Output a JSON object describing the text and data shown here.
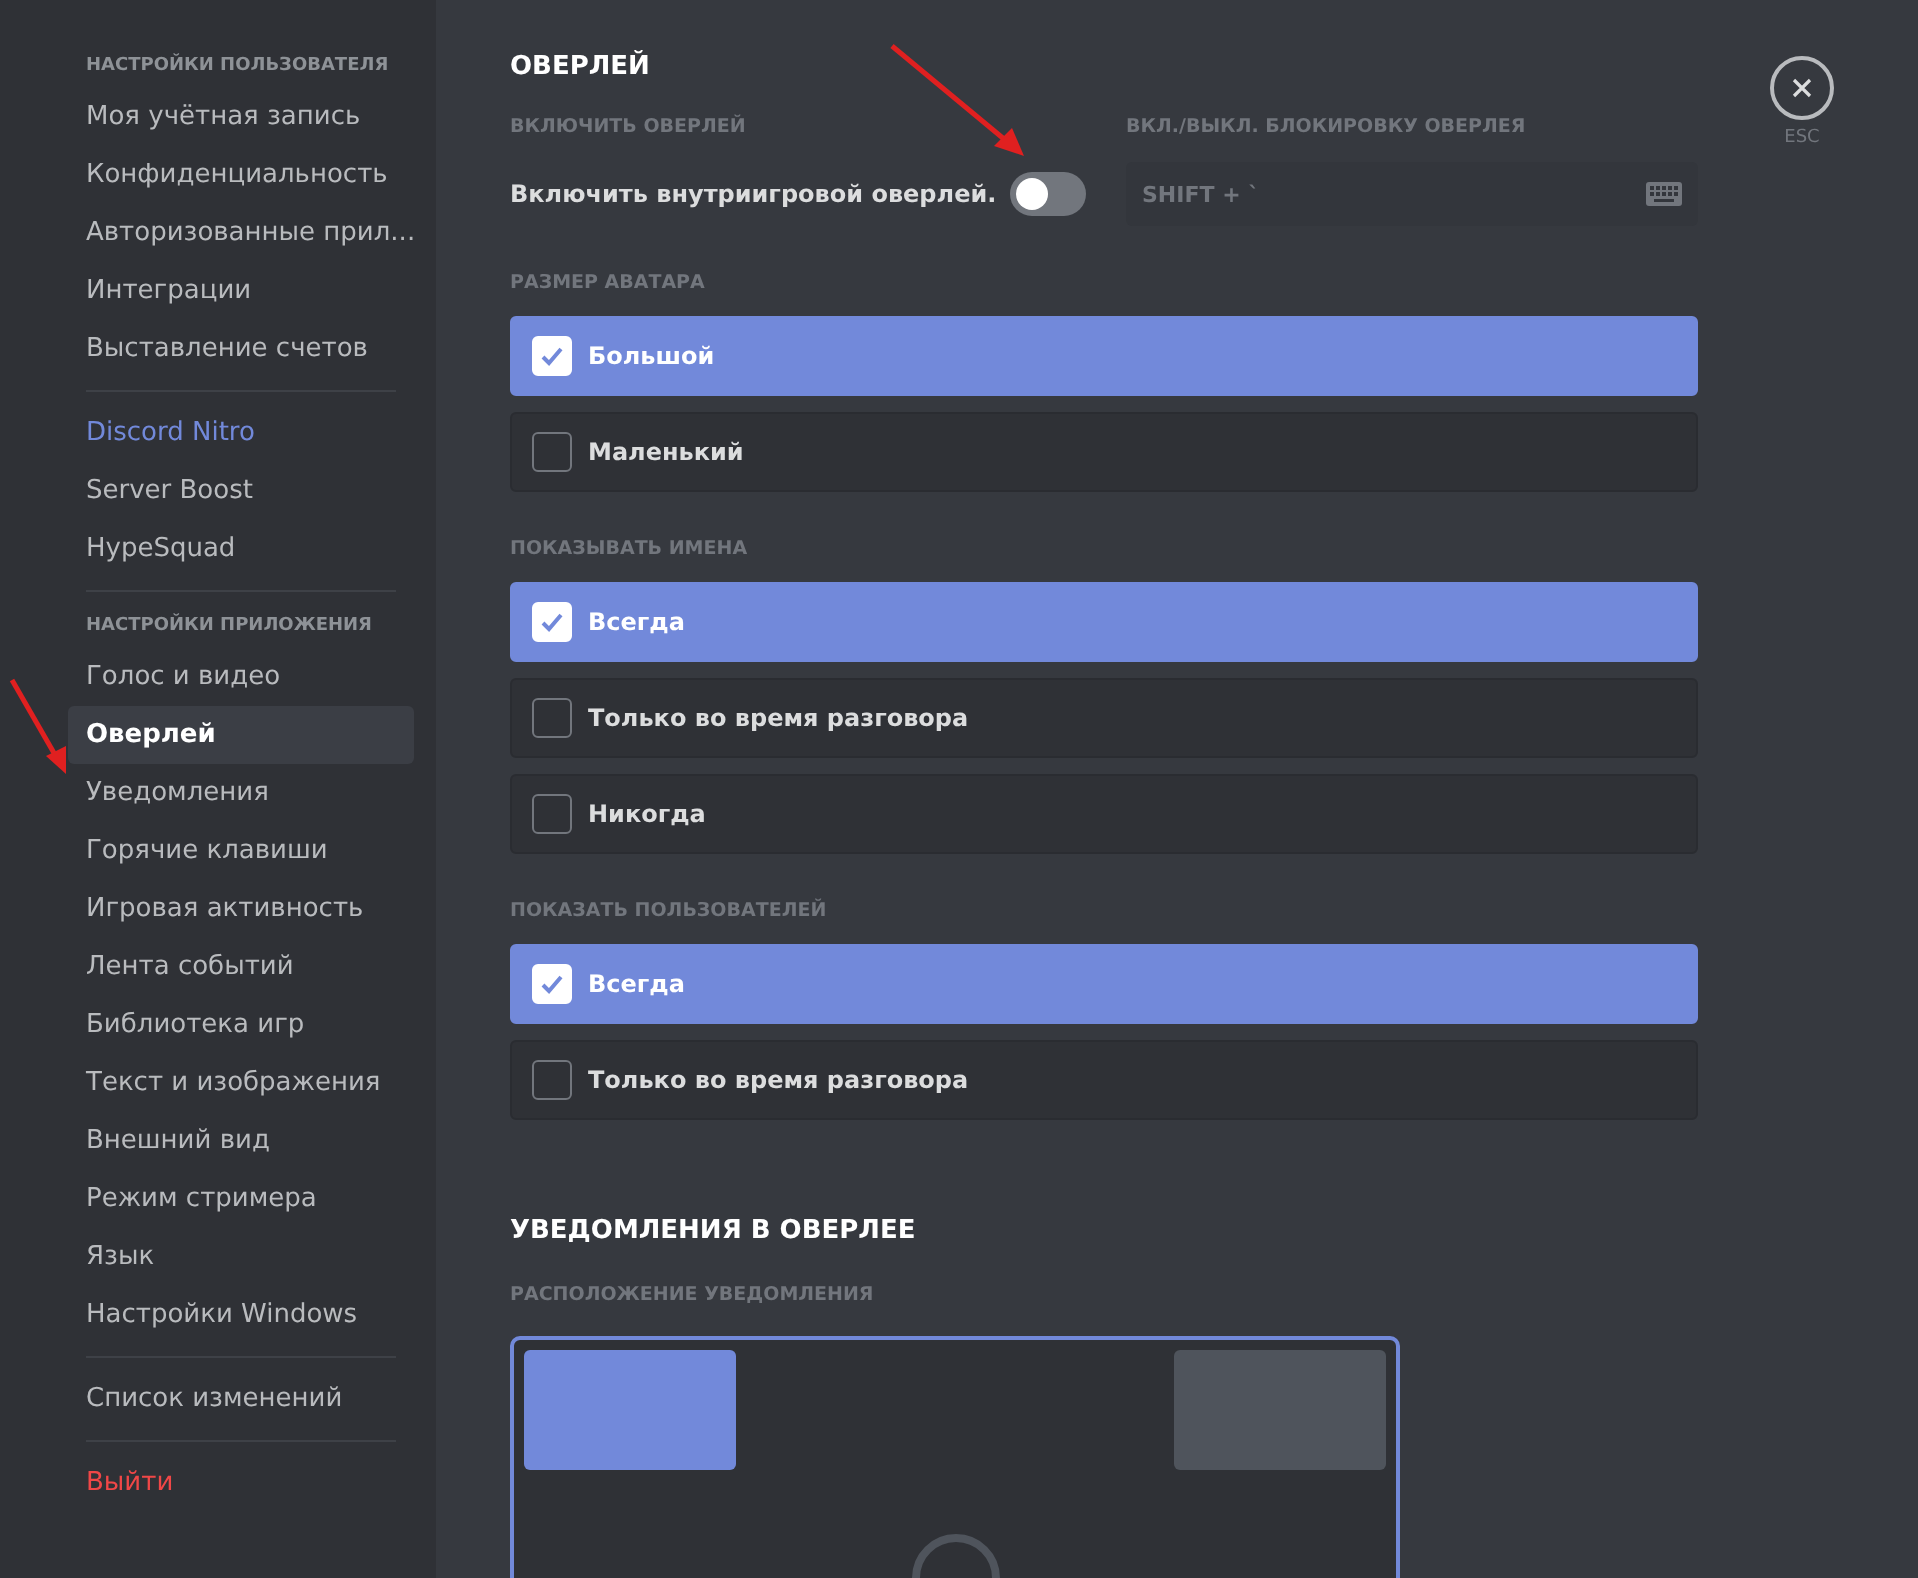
{
  "sidebar": {
    "sections": [
      {
        "header": "НАСТРОЙКИ ПОЛЬЗОВАТЕЛЯ",
        "items": [
          {
            "label": "Моя учётная запись",
            "kind": "normal",
            "selected": false
          },
          {
            "label": "Конфиденциальность",
            "kind": "normal",
            "selected": false
          },
          {
            "label": "Авторизованные прил...",
            "kind": "normal",
            "selected": false
          },
          {
            "label": "Интеграции",
            "kind": "normal",
            "selected": false
          },
          {
            "label": "Выставление счетов",
            "kind": "normal",
            "selected": false
          }
        ]
      },
      {
        "items": [
          {
            "label": "Discord Nitro",
            "kind": "accent",
            "selected": false
          },
          {
            "label": "Server Boost",
            "kind": "normal",
            "selected": false
          },
          {
            "label": "HypeSquad",
            "kind": "normal",
            "selected": false
          }
        ]
      },
      {
        "header": "НАСТРОЙКИ ПРИЛОЖЕНИЯ",
        "items": [
          {
            "label": "Голос и видео",
            "kind": "normal",
            "selected": false
          },
          {
            "label": "Оверлей",
            "kind": "normal",
            "selected": true
          },
          {
            "label": "Уведомления",
            "kind": "normal",
            "selected": false
          },
          {
            "label": "Горячие клавиши",
            "kind": "normal",
            "selected": false
          },
          {
            "label": "Игровая активность",
            "kind": "normal",
            "selected": false
          },
          {
            "label": "Лента событий",
            "kind": "normal",
            "selected": false
          },
          {
            "label": "Библиотека игр",
            "kind": "normal",
            "selected": false
          },
          {
            "label": "Текст и изображения",
            "kind": "normal",
            "selected": false
          },
          {
            "label": "Внешний вид",
            "kind": "normal",
            "selected": false
          },
          {
            "label": "Режим стримера",
            "kind": "normal",
            "selected": false
          },
          {
            "label": "Язык",
            "kind": "normal",
            "selected": false
          },
          {
            "label": "Настройки Windows",
            "kind": "normal",
            "selected": false
          }
        ]
      },
      {
        "items": [
          {
            "label": "Список изменений",
            "kind": "normal",
            "selected": false
          }
        ]
      },
      {
        "items": [
          {
            "label": "Выйти",
            "kind": "danger",
            "selected": false
          }
        ]
      }
    ]
  },
  "overlay": {
    "title": "ОВЕРЛЕЙ",
    "enable_header": "ВКЛЮЧИТЬ ОВЕРЛЕЙ",
    "toggle_label": "Включить внутриигровой оверлей.",
    "toggle_on": false,
    "keybind_header": "ВКЛ./ВЫКЛ. БЛОКИРОВКУ ОВЕРЛЕЯ",
    "keybind_value": "SHIFT + `"
  },
  "close": {
    "label": "ESC"
  },
  "option_groups": [
    {
      "title": "РАЗМЕР АВАТАРА",
      "options": [
        {
          "label": "Большой",
          "selected": true
        },
        {
          "label": "Маленький",
          "selected": false
        }
      ]
    },
    {
      "title": "ПОКАЗЫВАТЬ ИМЕНА",
      "options": [
        {
          "label": "Всегда",
          "selected": true
        },
        {
          "label": "Только во время разговора",
          "selected": false
        },
        {
          "label": "Никогда",
          "selected": false
        }
      ]
    },
    {
      "title": "ПОКАЗАТЬ ПОЛЬЗОВАТЕЛЕЙ",
      "options": [
        {
          "label": "Всегда",
          "selected": true
        },
        {
          "label": "Только во время разговора",
          "selected": false
        }
      ]
    }
  ],
  "notifications": {
    "title": "УВЕДОМЛЕНИЯ В ОВЕРЛЕЕ",
    "position_header": "РАСПОЛОЖЕНИЕ УВЕДОМЛЕНИЯ",
    "positions": [
      {
        "selected": true
      },
      {
        "selected": false
      }
    ]
  }
}
